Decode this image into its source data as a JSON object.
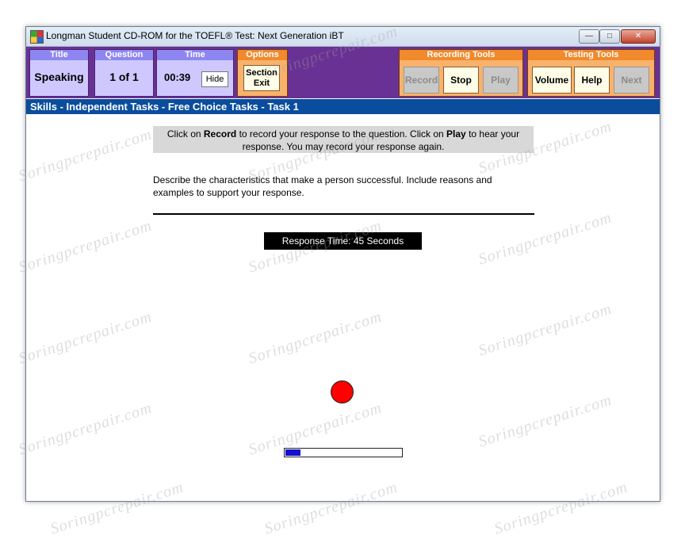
{
  "window": {
    "title": "Longman Student CD-ROM for the TOEFL® Test: Next Generation iBT",
    "controls": {
      "minimize": "—",
      "maximize": "□",
      "close": "✕"
    }
  },
  "toolbar": {
    "title": {
      "header": "Title",
      "value": "Speaking"
    },
    "question": {
      "header": "Question",
      "value": "1 of 1"
    },
    "time": {
      "header": "Time",
      "value": "00:39",
      "hide_label": "Hide"
    },
    "options": {
      "header": "Options",
      "section_exit_line1": "Section",
      "section_exit_line2": "Exit"
    },
    "recording_tools": {
      "header": "Recording Tools",
      "record": "Record",
      "stop": "Stop",
      "play": "Play"
    },
    "testing_tools": {
      "header": "Testing Tools",
      "volume": "Volume",
      "help": "Help",
      "next": "Next"
    }
  },
  "subheader": "Skills - Independent Tasks - Free Choice Tasks - Task 1",
  "instructions": {
    "p1": "Click on ",
    "record_word": "Record",
    "p2": " to record your response to the question. Click on ",
    "play_word": "Play",
    "p3": " to hear your response. You may record your response again."
  },
  "question_text": "Describe the characteristics that make a person successful. Include reasons and examples to support your response.",
  "response_time": "Response Time: 45 Seconds",
  "recording": {
    "progress_fraction": 0.13,
    "indicator_color": "#ff0000",
    "progress_color": "#1111cc"
  },
  "watermark": "Soringpcrepair.com",
  "colors": {
    "toolbar": "#6a3194",
    "subheader": "#0a4d9d",
    "tool_group": "#f9b26b",
    "info_group": "#cfc8ff"
  }
}
